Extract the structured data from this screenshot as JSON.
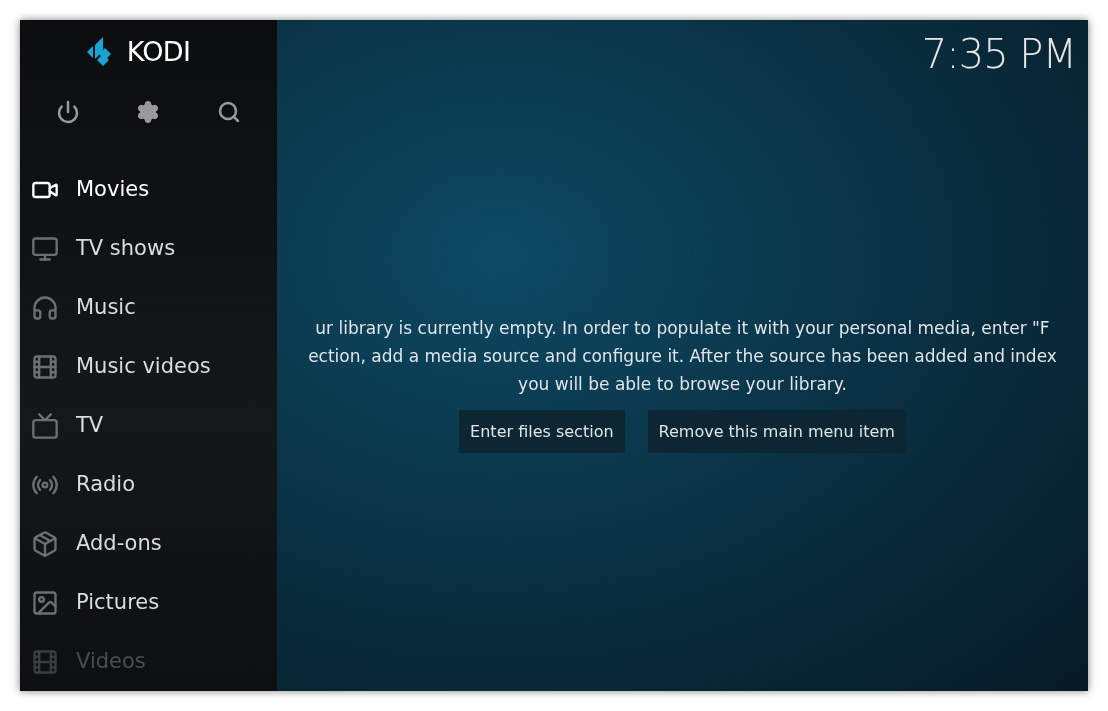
{
  "logo": {
    "text": "KODI"
  },
  "clock": "7:35 PM",
  "menu": [
    {
      "label": "Movies",
      "selected": true,
      "faded": false
    },
    {
      "label": "TV shows",
      "selected": false,
      "faded": false
    },
    {
      "label": "Music",
      "selected": false,
      "faded": false
    },
    {
      "label": "Music videos",
      "selected": false,
      "faded": false
    },
    {
      "label": "TV",
      "selected": false,
      "faded": false
    },
    {
      "label": "Radio",
      "selected": false,
      "faded": false
    },
    {
      "label": "Add-ons",
      "selected": false,
      "faded": false
    },
    {
      "label": "Pictures",
      "selected": false,
      "faded": false
    },
    {
      "label": "Videos",
      "selected": false,
      "faded": true
    }
  ],
  "message": [
    "ur library is currently empty. In order to populate it with your personal media, enter \"F",
    "ection, add a media source and configure it. After the source has been added and index",
    "you will be able to browse your library."
  ],
  "buttons": [
    "Enter files section",
    "Remove this main menu item"
  ]
}
